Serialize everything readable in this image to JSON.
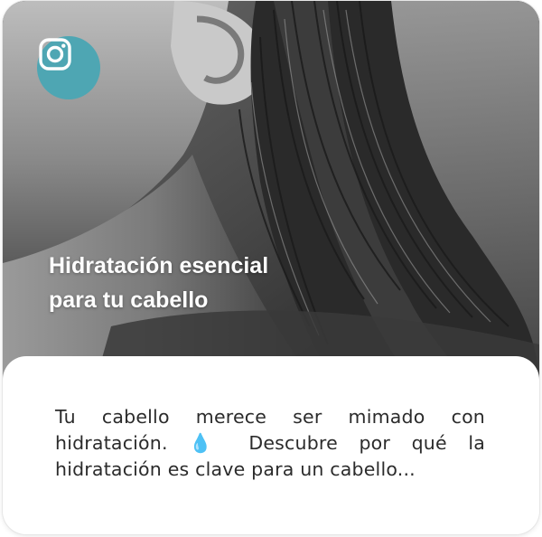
{
  "post": {
    "platform_icon": "instagram-icon",
    "title_line1": "Hidratación esencial",
    "title_line2": "para tu cabello",
    "excerpt": "Tu cabello merece ser mimado con hidratación. 💧 Descubre por qué la hidratación es clave para un cabello..."
  },
  "colors": {
    "badge": "#4ea6b3",
    "headline": "#ffffff",
    "excerpt": "#2b2b2b"
  }
}
